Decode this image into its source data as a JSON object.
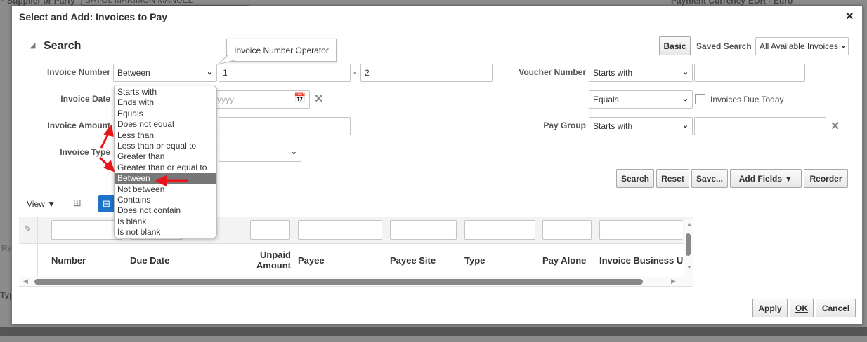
{
  "background": {
    "supplier_label": "Supplier or Party",
    "supplier_value": "SAYOL MARIMON MANUEL",
    "currency_label": "Payment Currency",
    "currency_value": "EUR - Euro",
    "partial_left_1": "Ra",
    "partial_left_2": "Typ"
  },
  "dialog": {
    "title": "Select and Add: Invoices to Pay",
    "close": "✕"
  },
  "search": {
    "header": "Search",
    "basic_label": "Basic",
    "saved_search_label": "Saved Search",
    "saved_search_value": "All Available Invoices",
    "tooltip": "Invoice Number Operator",
    "invoice_number": {
      "label": "Invoice Number",
      "operator": "Between",
      "value1": "1",
      "separator": "-",
      "value2": "2"
    },
    "invoice_date": {
      "label": "Invoice Date",
      "placeholder": "yyyy"
    },
    "invoice_amount": {
      "label": "Invoice Amount"
    },
    "invoice_type": {
      "label": "Invoice Type"
    },
    "voucher_number": {
      "label": "Voucher Number",
      "operator": "Starts with"
    },
    "due_today": {
      "operator": "Equals",
      "checkbox_label": "Invoices Due Today"
    },
    "pay_group": {
      "label": "Pay Group",
      "operator": "Starts with"
    },
    "operator_options": [
      "Starts with",
      "Ends with",
      "Equals",
      "Does not equal",
      "Less than",
      "Less than or equal to",
      "Greater than",
      "Greater than or equal to",
      "Between",
      "Not between",
      "Contains",
      "Does not contain",
      "Is blank",
      "Is not blank"
    ],
    "selected_option": "Between",
    "buttons": {
      "search": "Search",
      "reset": "Reset",
      "save": "Save...",
      "add_fields": "Add Fields ▼",
      "reorder": "Reorder"
    }
  },
  "table": {
    "view_label": "View ▼",
    "columns": [
      "Number",
      "Due Date",
      "Unpaid Amount",
      "Payee",
      "Payee Site",
      "Type",
      "Pay Alone",
      "Invoice Business U"
    ],
    "unpaid_line1": "Unpaid",
    "unpaid_line2": "Amount"
  },
  "footer": {
    "apply": "Apply",
    "ok": "OK",
    "cancel": "Cancel"
  },
  "colors": {
    "highlight": "#777777",
    "arrow": "#e8141a",
    "filter_icon": "#1d73c9"
  }
}
